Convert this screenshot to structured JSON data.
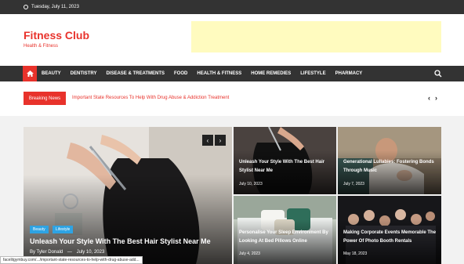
{
  "topbar": {
    "date": "Tuesday, July 11, 2023"
  },
  "header": {
    "title": "Fitness Club",
    "tagline": "Health & Fitness"
  },
  "nav": {
    "items": [
      "BEAUTY",
      "DENTISTRY",
      "DISEASE & TREATMENTS",
      "FOOD",
      "HEALTH & FITNESS",
      "HOME REMEDIES",
      "LIFESTYLE",
      "PHARMACY"
    ]
  },
  "breaking": {
    "label": "Breaking News",
    "headline": "Important State Resources To Help With Drug Abuse & Addiction Treatment"
  },
  "featured": {
    "tags": [
      "Beauty",
      "Lifestyle"
    ],
    "title": "Unleash Your Style With The Best Hair Stylist Near Me",
    "author": "By Tyler Donald",
    "date": "July 10, 2023"
  },
  "grid": [
    {
      "title": "Unleash Your Style With The Best Hair Stylist Near Me",
      "date": "July 10, 2023"
    },
    {
      "title": "Generational Lullabies: Fostering Bonds Through Music",
      "date": "July 7, 2023"
    },
    {
      "title": "Personalise Your Sleep Environment By Looking At Bed Pillows Online",
      "date": "July 4, 2023"
    },
    {
      "title": "Making Corporate Events Memorable The Power Of Photo Booth Rentals",
      "date": "May 18, 2023"
    }
  ],
  "status": {
    "url": "facelitgymbuy.com/.../important-state-resources-to-help-with-drug-abuse-add..."
  },
  "colors": {
    "accent": "#e8322b",
    "dark": "#333333",
    "ad": "#fffbbf",
    "tag": "#2ea3e3"
  }
}
